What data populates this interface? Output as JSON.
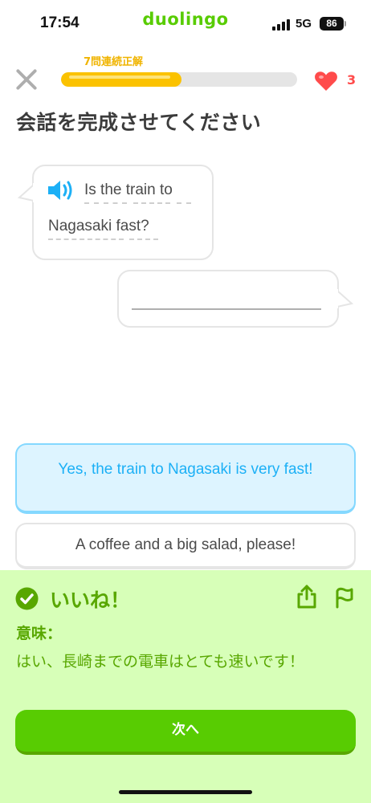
{
  "status_bar": {
    "time": "17:54",
    "app_name": "duolingo",
    "network": "5G",
    "battery": "86"
  },
  "header": {
    "streak_label": "7問連続正解",
    "progress": 0.51,
    "hearts": "3",
    "accent_color": "#fbc200",
    "heart_color": "#ff4b4b"
  },
  "prompt": "会話を完成させてください",
  "question": {
    "line1": "Is the train to",
    "line2": "Nagasaki fast?",
    "icon": "speaker-icon"
  },
  "choices": [
    {
      "label": "Yes, the train to Nagasaki is very fast!",
      "selected": true
    },
    {
      "label": "A coffee and a big salad, please!",
      "selected": false
    }
  ],
  "feedback": {
    "title": "いいね！",
    "meaning_label": "意味：",
    "meaning_text": "はい、長崎までの電車はとても速いです！",
    "next_label": "次へ",
    "color": "#58a700"
  }
}
